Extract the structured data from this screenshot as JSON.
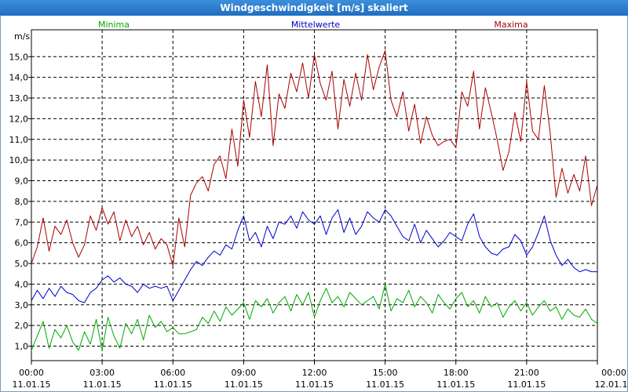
{
  "window": {
    "title": "Windgeschwindigkeit [m/s] skaliert"
  },
  "chart_data": {
    "type": "line",
    "title": "Windgeschwindigkeit [m/s] skaliert",
    "ylabel": "m/s",
    "ylim": [
      0.3,
      16.3
    ],
    "xlim": [
      0,
      24
    ],
    "grid": true,
    "legend_position": "top",
    "x_ticks": [
      {
        "hours": 0,
        "time": "00:00",
        "date": "11.01.15"
      },
      {
        "hours": 3,
        "time": "03:00",
        "date": "11.01.15"
      },
      {
        "hours": 6,
        "time": "06:00",
        "date": "11.01.15"
      },
      {
        "hours": 9,
        "time": "09:00",
        "date": "11.01.15"
      },
      {
        "hours": 12,
        "time": "12:00",
        "date": "11.01.15"
      },
      {
        "hours": 15,
        "time": "15:00",
        "date": "11.01.15"
      },
      {
        "hours": 18,
        "time": "18:00",
        "date": "11.01.15"
      },
      {
        "hours": 21,
        "time": "21:00",
        "date": "11.01.15"
      },
      {
        "hours": 24,
        "time": "00:00",
        "date": "12.01.15"
      }
    ],
    "y_ticks": [
      "1,0",
      "2,0",
      "3,0",
      "4,0",
      "5,0",
      "6,0",
      "7,0",
      "8,0",
      "9,0",
      "10,0",
      "11,0",
      "12,0",
      "13,0",
      "14,0",
      "15,0"
    ],
    "y_tick_values": [
      1,
      2,
      3,
      4,
      5,
      6,
      7,
      8,
      9,
      10,
      11,
      12,
      13,
      14,
      15
    ],
    "series": [
      {
        "name": "Minima",
        "color": "#00aa00",
        "x": [
          0,
          0.25,
          0.5,
          0.75,
          1,
          1.25,
          1.5,
          1.75,
          2,
          2.25,
          2.5,
          2.75,
          3,
          3.25,
          3.5,
          3.75,
          4,
          4.25,
          4.5,
          4.75,
          5,
          5.25,
          5.5,
          5.75,
          6,
          6.25,
          6.5,
          6.75,
          7,
          7.25,
          7.5,
          7.75,
          8,
          8.25,
          8.5,
          8.75,
          9,
          9.25,
          9.5,
          9.75,
          10,
          10.25,
          10.5,
          10.75,
          11,
          11.25,
          11.5,
          11.75,
          12,
          12.25,
          12.5,
          12.75,
          13,
          13.25,
          13.5,
          13.75,
          14,
          14.25,
          14.5,
          14.75,
          15,
          15.25,
          15.5,
          15.75,
          16,
          16.25,
          16.5,
          16.75,
          17,
          17.25,
          17.5,
          17.75,
          18,
          18.25,
          18.5,
          18.75,
          19,
          19.25,
          19.5,
          19.75,
          20,
          20.25,
          20.5,
          20.75,
          21,
          21.25,
          21.5,
          21.75,
          22,
          22.25,
          22.5,
          22.75,
          23,
          23.25,
          23.5,
          23.75,
          24
        ],
        "values": [
          0.8,
          1.5,
          2.2,
          0.9,
          1.8,
          1.4,
          2.0,
          1.2,
          0.8,
          1.7,
          1.1,
          2.3,
          0.8,
          2.4,
          1.5,
          0.9,
          2.1,
          1.6,
          2.3,
          1.3,
          2.5,
          1.9,
          2.2,
          1.7,
          1.9,
          1.6,
          1.6,
          1.7,
          1.8,
          2.4,
          2.1,
          2.7,
          2.2,
          2.9,
          2.5,
          2.8,
          3.1,
          2.3,
          3.2,
          2.9,
          3.3,
          2.6,
          3.1,
          3.4,
          2.7,
          3.5,
          3.0,
          3.6,
          2.4,
          3.2,
          3.8,
          3.1,
          3.4,
          2.9,
          3.6,
          3.3,
          3.0,
          3.2,
          3.4,
          2.8,
          4.0,
          2.7,
          3.3,
          3.1,
          3.7,
          2.9,
          3.4,
          3.1,
          2.6,
          3.5,
          3.1,
          2.8,
          3.3,
          3.6,
          2.9,
          3.2,
          2.6,
          3.4,
          2.9,
          3.1,
          2.4,
          2.9,
          3.2,
          2.7,
          3.1,
          2.5,
          2.9,
          3.2,
          2.7,
          2.9,
          2.3,
          2.8,
          2.5,
          2.4,
          2.8,
          2.3,
          2.1
        ]
      },
      {
        "name": "Mittelwerte",
        "color": "#0000cc",
        "x": [
          0,
          0.25,
          0.5,
          0.75,
          1,
          1.25,
          1.5,
          1.75,
          2,
          2.25,
          2.5,
          2.75,
          3,
          3.25,
          3.5,
          3.75,
          4,
          4.25,
          4.5,
          4.75,
          5,
          5.25,
          5.5,
          5.75,
          6,
          6.25,
          6.5,
          6.75,
          7,
          7.25,
          7.5,
          7.75,
          8,
          8.25,
          8.5,
          8.75,
          9,
          9.25,
          9.5,
          9.75,
          10,
          10.25,
          10.5,
          10.75,
          11,
          11.25,
          11.5,
          11.75,
          12,
          12.25,
          12.5,
          12.75,
          13,
          13.25,
          13.5,
          13.75,
          14,
          14.25,
          14.5,
          14.75,
          15,
          15.25,
          15.5,
          15.75,
          16,
          16.25,
          16.5,
          16.75,
          17,
          17.25,
          17.5,
          17.75,
          18,
          18.25,
          18.5,
          18.75,
          19,
          19.25,
          19.5,
          19.75,
          20,
          20.25,
          20.5,
          20.75,
          21,
          21.25,
          21.5,
          21.75,
          22,
          22.25,
          22.5,
          22.75,
          23,
          23.25,
          23.5,
          23.75,
          24
        ],
        "values": [
          3.2,
          3.7,
          3.3,
          3.8,
          3.4,
          3.9,
          3.6,
          3.5,
          3.2,
          3.1,
          3.6,
          3.8,
          4.2,
          4.4,
          4.1,
          4.3,
          4.0,
          3.9,
          3.6,
          4.0,
          3.8,
          3.9,
          3.8,
          3.9,
          3.2,
          3.7,
          4.2,
          4.7,
          5.1,
          4.9,
          5.3,
          5.6,
          5.4,
          5.9,
          5.7,
          6.6,
          7.3,
          6.1,
          6.5,
          5.8,
          6.8,
          6.2,
          7.0,
          6.9,
          7.3,
          6.7,
          7.5,
          7.1,
          6.9,
          7.3,
          6.4,
          7.2,
          7.6,
          6.5,
          7.2,
          6.4,
          6.8,
          7.5,
          7.2,
          7.0,
          7.6,
          7.3,
          6.8,
          6.3,
          6.1,
          6.9,
          6.0,
          6.6,
          6.2,
          5.8,
          6.1,
          6.5,
          6.3,
          6.1,
          6.9,
          7.4,
          6.3,
          5.8,
          5.5,
          5.4,
          5.7,
          5.8,
          6.4,
          6.1,
          5.4,
          5.8,
          6.5,
          7.3,
          6.1,
          5.4,
          4.9,
          5.2,
          4.8,
          4.6,
          4.7,
          4.6,
          4.6
        ]
      },
      {
        "name": "Maxima",
        "color": "#aa0000",
        "x": [
          0,
          0.25,
          0.5,
          0.75,
          1,
          1.25,
          1.5,
          1.75,
          2,
          2.25,
          2.5,
          2.75,
          3,
          3.25,
          3.5,
          3.75,
          4,
          4.25,
          4.5,
          4.75,
          5,
          5.25,
          5.5,
          5.75,
          6,
          6.25,
          6.5,
          6.75,
          7,
          7.25,
          7.5,
          7.75,
          8,
          8.25,
          8.5,
          8.75,
          9,
          9.25,
          9.5,
          9.75,
          10,
          10.25,
          10.5,
          10.75,
          11,
          11.25,
          11.5,
          11.75,
          12,
          12.25,
          12.5,
          12.75,
          13,
          13.25,
          13.5,
          13.75,
          14,
          14.25,
          14.5,
          14.75,
          15,
          15.25,
          15.5,
          15.75,
          16,
          16.25,
          16.5,
          16.75,
          17,
          17.25,
          17.5,
          17.75,
          18,
          18.25,
          18.5,
          18.75,
          19,
          19.25,
          19.5,
          19.75,
          20,
          20.25,
          20.5,
          20.75,
          21,
          21.25,
          21.5,
          21.75,
          22,
          22.25,
          22.5,
          22.75,
          23,
          23.25,
          23.5,
          23.75,
          24
        ],
        "values": [
          5.0,
          5.8,
          7.2,
          5.6,
          6.8,
          6.4,
          7.1,
          6.0,
          5.3,
          5.9,
          7.3,
          6.6,
          7.7,
          6.9,
          7.5,
          6.1,
          7.1,
          6.3,
          6.8,
          5.9,
          6.5,
          5.7,
          6.2,
          5.9,
          4.9,
          7.2,
          5.8,
          8.3,
          8.9,
          9.2,
          8.5,
          9.8,
          10.2,
          9.1,
          11.5,
          9.7,
          12.9,
          11.1,
          13.8,
          12.1,
          14.6,
          10.7,
          13.2,
          12.5,
          14.2,
          13.3,
          14.7,
          13.0,
          15.1,
          13.7,
          12.9,
          14.3,
          11.5,
          13.9,
          12.6,
          14.2,
          12.9,
          15.1,
          13.4,
          14.5,
          15.3,
          12.9,
          12.1,
          13.3,
          11.4,
          12.7,
          10.8,
          12.1,
          11.2,
          10.7,
          10.9,
          11.0,
          10.6,
          13.3,
          12.6,
          14.3,
          11.5,
          13.5,
          12.3,
          11.0,
          9.5,
          10.4,
          12.3,
          10.9,
          13.8,
          11.4,
          11.0,
          13.6,
          11.3,
          8.2,
          9.6,
          8.4,
          9.3,
          8.5,
          10.2,
          7.8,
          8.8
        ]
      }
    ]
  }
}
